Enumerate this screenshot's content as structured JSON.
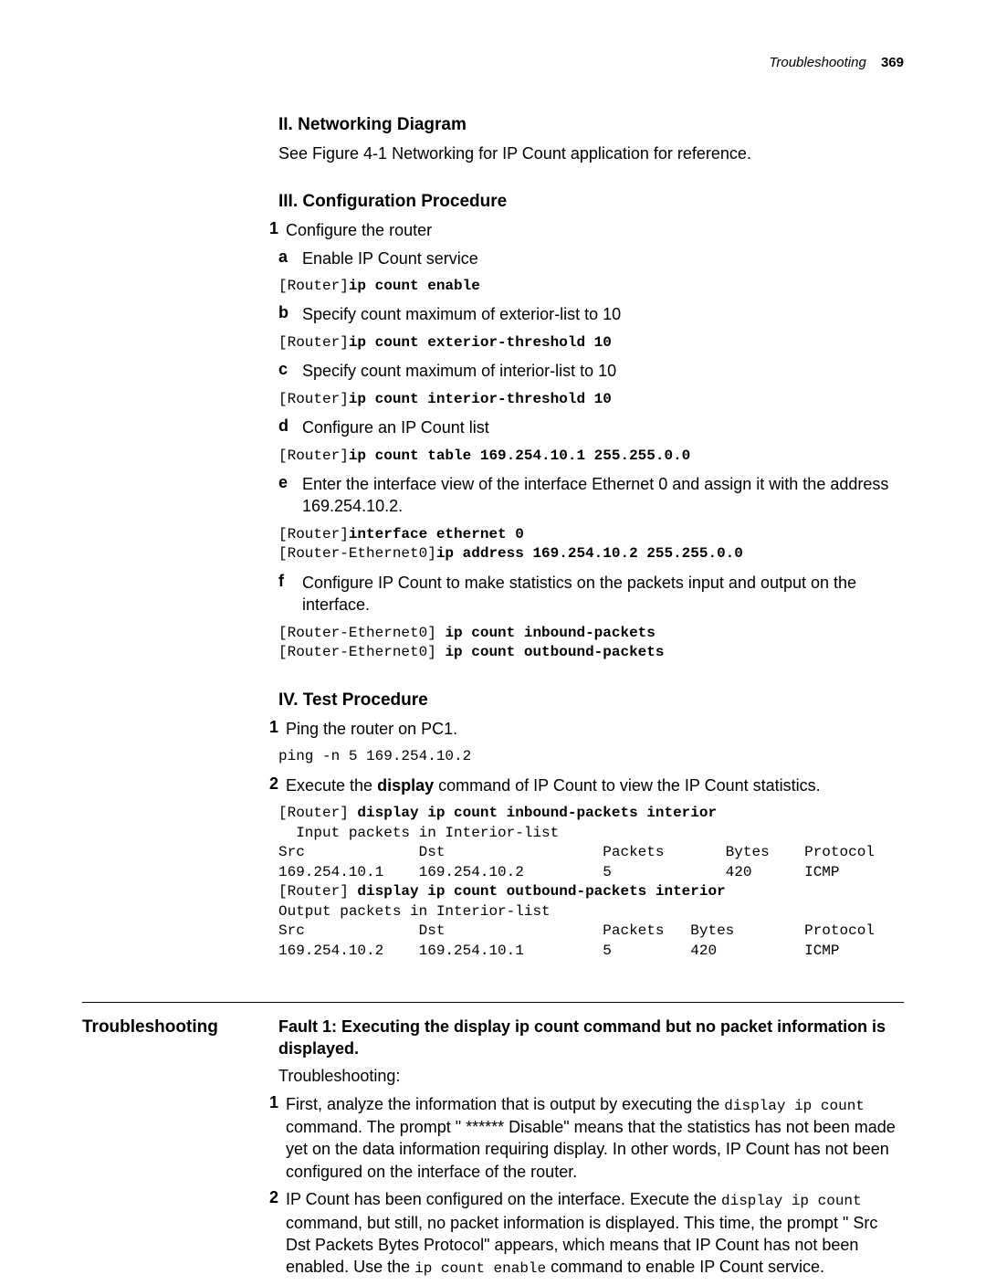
{
  "header": {
    "section": "Troubleshooting",
    "page_number": "369"
  },
  "s2": {
    "heading": "II. Networking Diagram",
    "text": "See Figure 4-1 Networking for IP Count application for reference."
  },
  "s3": {
    "heading": "III. Configuration Procedure",
    "step1": {
      "num": "1",
      "text": "Configure the router",
      "a": {
        "label": "a",
        "text": "Enable IP Count service"
      },
      "code_a_prompt": "[Router]",
      "code_a_cmd": "ip count enable",
      "b": {
        "label": "b",
        "text": "Specify count maximum of exterior-list to 10"
      },
      "code_b_prompt": "[Router]",
      "code_b_cmd": "ip count exterior-threshold 10",
      "c": {
        "label": "c",
        "text": "Specify count maximum of interior-list to 10"
      },
      "code_c_prompt": "[Router]",
      "code_c_cmd": "ip count interior-threshold 10",
      "d": {
        "label": "d",
        "text": "Configure an IP Count list"
      },
      "code_d_prompt": "[Router]",
      "code_d_cmd": "ip count table 169.254.10.1 255.255.0.0",
      "e": {
        "label": "e",
        "text": "Enter the interface view of the interface Ethernet 0 and assign it with the address 169.254.10.2."
      },
      "code_e_line1_prompt": "[Router]",
      "code_e_line1_cmd": "interface ethernet 0",
      "code_e_line2_prompt": "[Router-Ethernet0]",
      "code_e_line2_cmd": "ip address 169.254.10.2 255.255.0.0",
      "f": {
        "label": "f",
        "text": "Configure IP Count to make statistics on the packets input and output on the interface."
      },
      "code_f_line1": "[Router-Ethernet0] ",
      "code_f_line1_cmd": "ip count inbound-packets",
      "code_f_line2": "[Router-Ethernet0] ",
      "code_f_line2_cmd": "ip count outbound-packets"
    }
  },
  "s4": {
    "heading": "IV. Test Procedure",
    "step1": {
      "num": "1",
      "text": "Ping the router on PC1."
    },
    "code1": "ping -n 5 169.254.10.2",
    "step2": {
      "num": "2",
      "pre": "Execute the ",
      "bold": "display",
      "post": " command of IP Count to view the IP Count statistics."
    },
    "out_prompt1": "[Router] ",
    "out_cmd1": "display ip count inbound-packets interior",
    "out_line2": "  Input packets in Interior-list",
    "out_line3": "Src             Dst                  Packets       Bytes    Protocol",
    "out_line4": "169.254.10.1    169.254.10.2         5             420      ICMP",
    "out_prompt2": "[Router] ",
    "out_cmd2": "display ip count outbound-packets interior",
    "out_line6": "Output packets in Interior-list",
    "out_line7": "Src             Dst                  Packets   Bytes        Protocol",
    "out_line8": "169.254.10.2    169.254.10.1         5         420          ICMP"
  },
  "ts": {
    "side": "Troubleshooting",
    "fault_title": "Fault 1: Executing the display ip count command but no packet information is displayed.",
    "intro": "Troubleshooting:",
    "step1": {
      "num": "1",
      "pre": "First, analyze the information that is output by executing the ",
      "code": "display ip count",
      "post": " command. The prompt \" ****** Disable\" means that the statistics has not been made yet on the data information requiring display. In other words, IP Count has not been configured on the interface of the router."
    },
    "step2": {
      "num": "2",
      "pre": "IP Count has been configured on the interface. Execute the ",
      "code1": "display ip count",
      "mid": " command, but still, no packet information is displayed. This time, the prompt \" Src   Dst   Packets    Bytes    Protocol\" appears, which means that IP Count has not been enabled. Use the ",
      "code2": "ip count enable",
      "post": " command to enable IP Count service."
    }
  }
}
